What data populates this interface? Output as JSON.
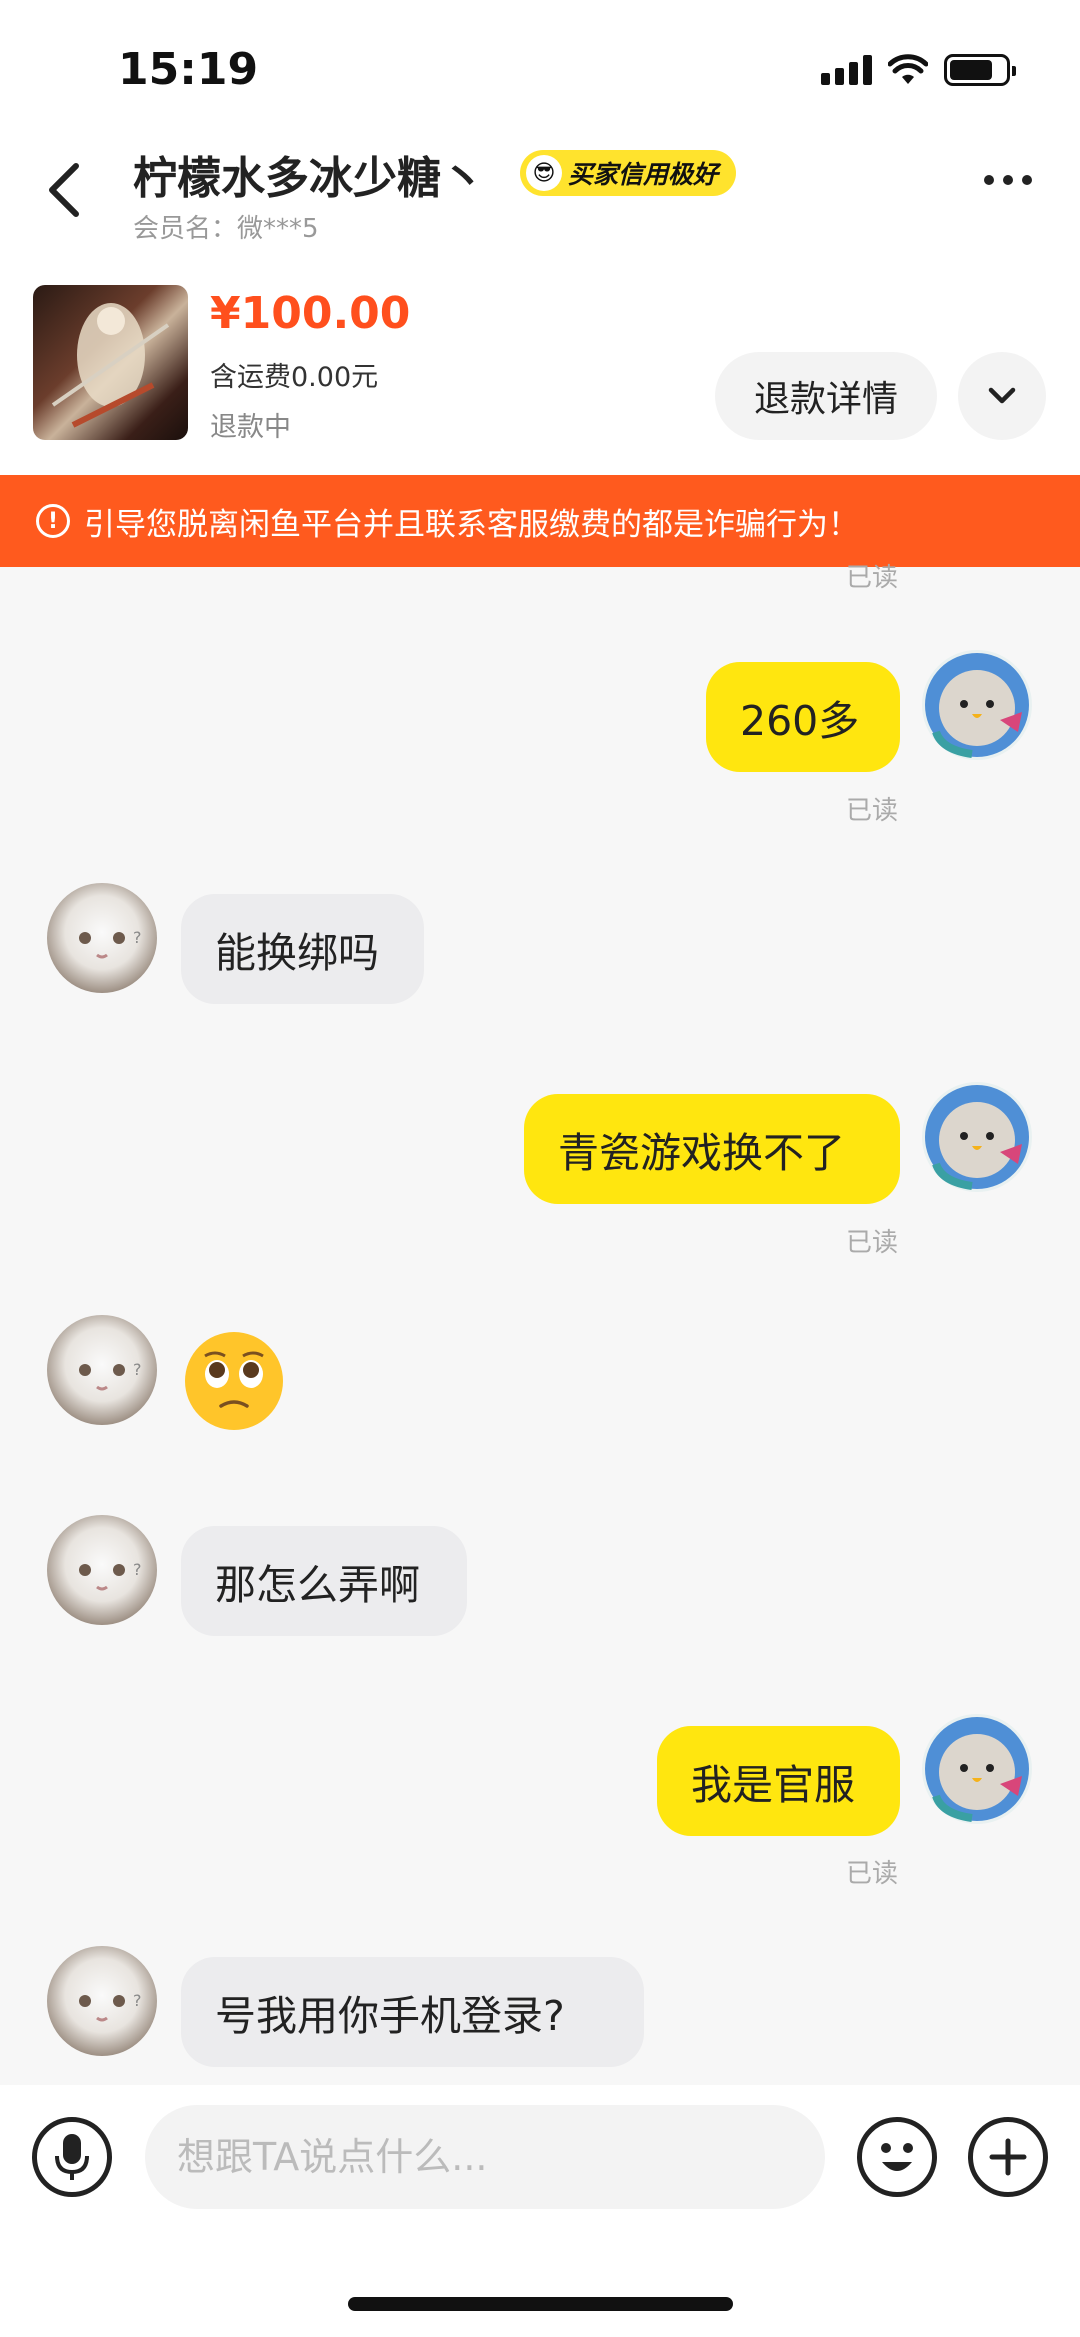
{
  "status_bar": {
    "time": "15:19"
  },
  "header": {
    "title": "柠檬水多冰少糖丶",
    "badge": "买家信用极好",
    "subtitle": "会员名：微***5"
  },
  "product": {
    "price": "¥100.00",
    "shipping": "含运费0.00元",
    "status": "退款中",
    "refund_button": "退款详情"
  },
  "warning": {
    "text": "引导您脱离闲鱼平台并且联系客服缴费的都是诈骗行为！"
  },
  "messages": [
    {
      "side": "me",
      "text": "260多",
      "read": "已读"
    },
    {
      "side": "them",
      "text": "能换绑吗"
    },
    {
      "side": "me",
      "text": "青瓷游戏换不了",
      "read": "已读"
    },
    {
      "side": "them",
      "emoji": "pleading-face"
    },
    {
      "side": "them",
      "text": "那怎么弄啊"
    },
    {
      "side": "me",
      "text": "我是官服",
      "read": "已读"
    },
    {
      "side": "them",
      "text": "号我用你手机登录?"
    }
  ],
  "top_partial_read": "已读",
  "input": {
    "placeholder": "想跟TA说点什么..."
  },
  "colors": {
    "accent_yellow": "#ffe60f",
    "price_orange": "#ff4f1d",
    "warning_bg": "#ff5a1e"
  }
}
